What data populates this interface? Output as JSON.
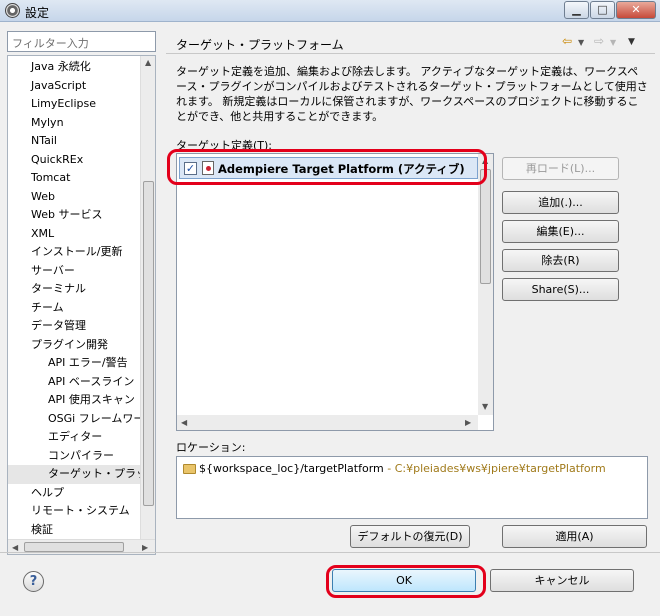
{
  "window": {
    "title": "設定",
    "buttons": {
      "minimize": "▁",
      "maximize": "□",
      "close": "✕"
    }
  },
  "sidebar": {
    "filter_placeholder": "フィルター入力",
    "items": [
      {
        "label": "Java 永続化",
        "level": 0
      },
      {
        "label": "JavaScript",
        "level": 0
      },
      {
        "label": "LimyEclipse",
        "level": 0
      },
      {
        "label": "Mylyn",
        "level": 0
      },
      {
        "label": "NTail",
        "level": 0
      },
      {
        "label": "QuickREx",
        "level": 0
      },
      {
        "label": "Tomcat",
        "level": 0
      },
      {
        "label": "Web",
        "level": 0
      },
      {
        "label": "Web サービス",
        "level": 0
      },
      {
        "label": "XML",
        "level": 0
      },
      {
        "label": "インストール/更新",
        "level": 0
      },
      {
        "label": "サーバー",
        "level": 0
      },
      {
        "label": "ターミナル",
        "level": 0
      },
      {
        "label": "チーム",
        "level": 0
      },
      {
        "label": "データ管理",
        "level": 0
      },
      {
        "label": "プラグイン開発",
        "level": 0
      },
      {
        "label": "API エラー/警告",
        "level": 1
      },
      {
        "label": "API ベースライン",
        "level": 1
      },
      {
        "label": "API 使用スキャン",
        "level": 1
      },
      {
        "label": "OSGi フレームワーク",
        "level": 1
      },
      {
        "label": "エディター",
        "level": 1
      },
      {
        "label": "コンパイラー",
        "level": 1
      },
      {
        "label": "ターゲット・プラットフォーム",
        "level": 1,
        "selected": true
      },
      {
        "label": "ヘルプ",
        "level": 0
      },
      {
        "label": "リモート・システム",
        "level": 0
      },
      {
        "label": "検証",
        "level": 0
      }
    ]
  },
  "page": {
    "title": "ターゲット・プラットフォーム",
    "description": "ターゲット定義を追加、編集および除去します。 アクティブなターゲット定義は、ワークスペース・プラグインがコンパイルおよびテストされるターゲット・プラットフォームとして使用されます。 新規定義はローカルに保管されますが、ワークスペースのプロジェクトに移動することができ、他と共用することができます。",
    "definitions_label": "ターゲット定義(T):",
    "targets": [
      {
        "name": "Adempiere Target Platform (アクティブ)",
        "checked": true
      }
    ],
    "buttons": {
      "reload": "再ロード(L)...",
      "add": "追加(.)...",
      "edit": "編集(E)...",
      "remove": "除去(R)",
      "share": "Share(S)..."
    },
    "location_label": "ロケーション:",
    "location_value": "${workspace_loc}/targetPlatform",
    "location_path": " - C:¥pleiades¥ws¥jpiere¥targetPlatform",
    "restore_defaults": "デフォルトの復元(D)",
    "apply": "適用(A)"
  },
  "footer": {
    "help": "?",
    "ok": "OK",
    "cancel": "キャンセル"
  },
  "colors": {
    "highlight": "#e3001b",
    "selection": "#dbe7f6"
  }
}
